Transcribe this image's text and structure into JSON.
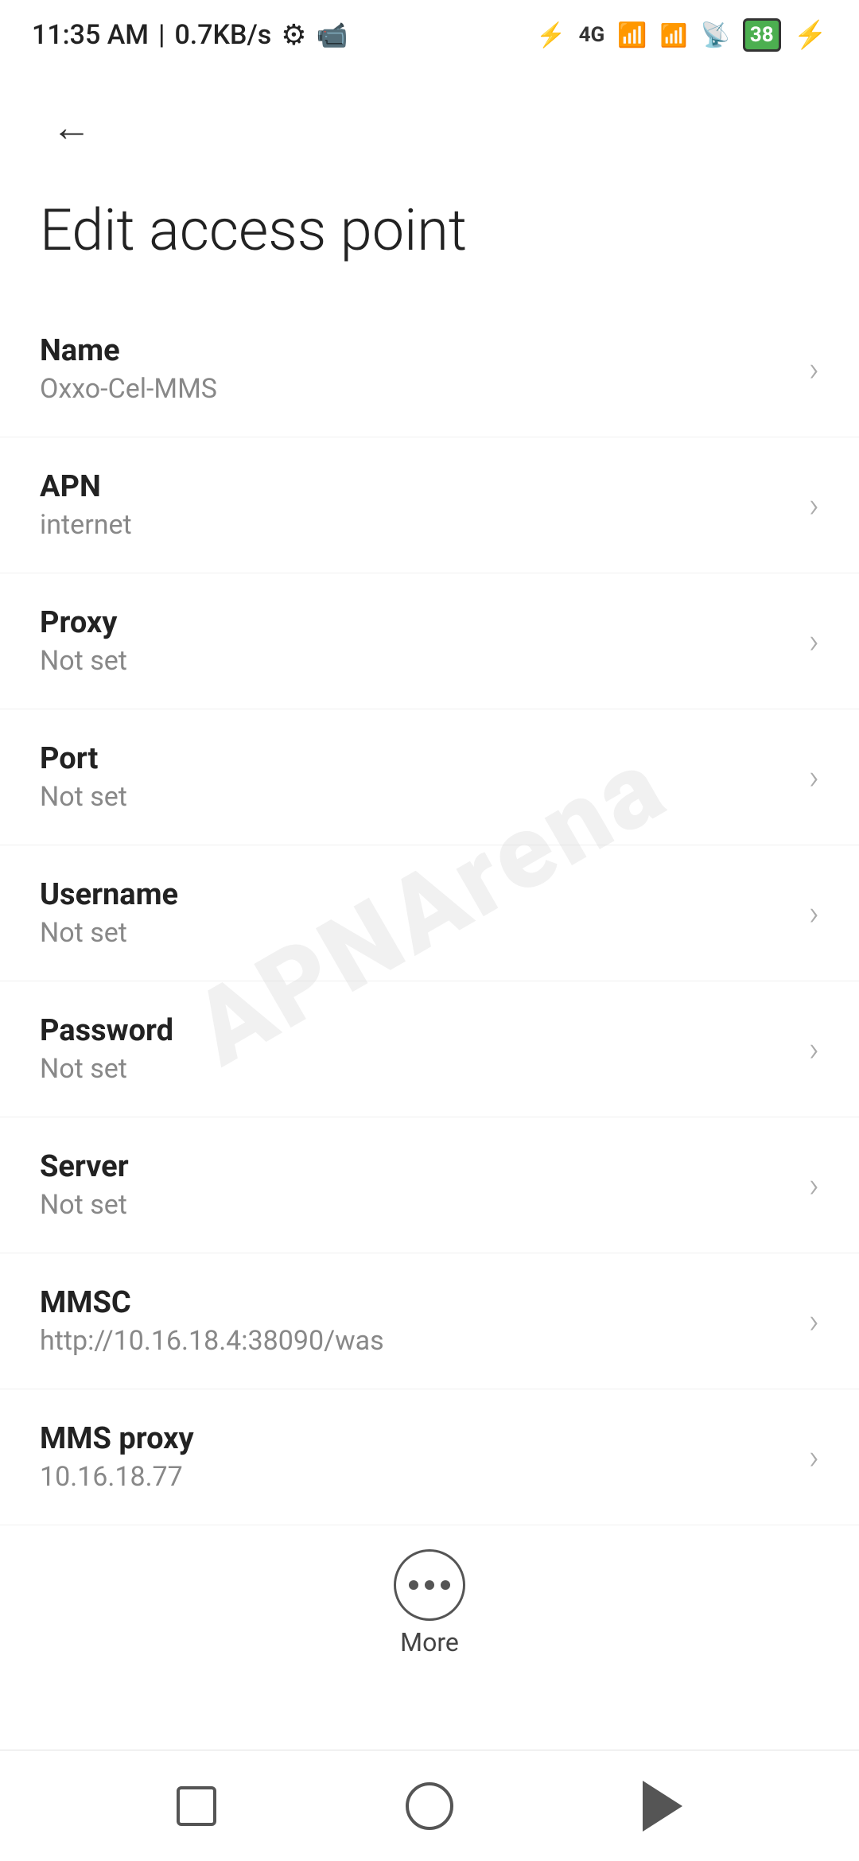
{
  "statusBar": {
    "time": "11:35 AM",
    "network": "0.7KB/s",
    "battery": "38"
  },
  "header": {
    "backLabel": "←",
    "title": "Edit access point"
  },
  "settings": [
    {
      "id": "name",
      "label": "Name",
      "value": "Oxxo-Cel-MMS"
    },
    {
      "id": "apn",
      "label": "APN",
      "value": "internet"
    },
    {
      "id": "proxy",
      "label": "Proxy",
      "value": "Not set"
    },
    {
      "id": "port",
      "label": "Port",
      "value": "Not set"
    },
    {
      "id": "username",
      "label": "Username",
      "value": "Not set"
    },
    {
      "id": "password",
      "label": "Password",
      "value": "Not set"
    },
    {
      "id": "server",
      "label": "Server",
      "value": "Not set"
    },
    {
      "id": "mmsc",
      "label": "MMSC",
      "value": "http://10.16.18.4:38090/was"
    },
    {
      "id": "mms-proxy",
      "label": "MMS proxy",
      "value": "10.16.18.77"
    }
  ],
  "more": {
    "label": "More"
  },
  "watermark": "APNArena",
  "navbar": {
    "square": "recent-apps",
    "circle": "home",
    "triangle": "back"
  }
}
